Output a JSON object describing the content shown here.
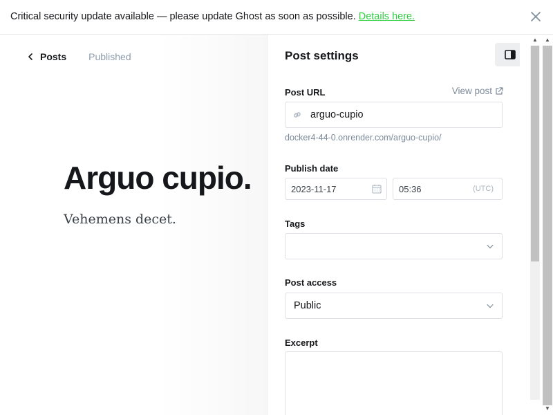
{
  "banner": {
    "text": "Critical security update available — please update Ghost as soon as possible.",
    "link": "Details here.",
    "close_icon": "close-icon"
  },
  "editor": {
    "back_label": "Posts",
    "status": "Published",
    "title": "Arguo cupio.",
    "body": "Vehemens decet."
  },
  "settings": {
    "title": "Post settings",
    "url": {
      "label": "Post URL",
      "view_post": "View post",
      "value": "arguo-cupio",
      "hint": "docker4-44-0.onrender.com/arguo-cupio/"
    },
    "publish_date": {
      "label": "Publish date",
      "date": "2023-11-17",
      "time": "05:36",
      "timezone": "(UTC)"
    },
    "tags": {
      "label": "Tags",
      "value": ""
    },
    "access": {
      "label": "Post access",
      "value": "Public"
    },
    "excerpt": {
      "label": "Excerpt",
      "value": ""
    }
  },
  "colors": {
    "accent_green": "#30cf43",
    "muted": "#7c8b9a"
  }
}
